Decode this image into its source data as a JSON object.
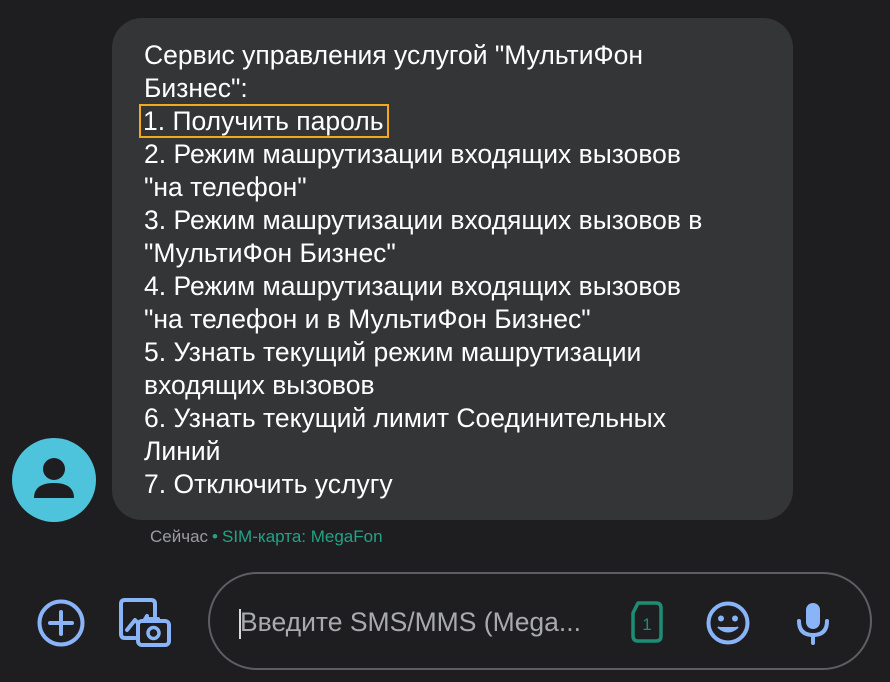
{
  "conversation": {
    "message": {
      "lines": [
        "Сервис управления услугой \"МультиФон",
        "Бизнес\":",
        "1. Получить пароль",
        "2. Режим машрутизации входящих вызовов",
        "\"на телефон\"",
        "3. Режим машрутизации входящих вызовов в",
        "\"МультиФон Бизнес\"",
        "4. Режим машрутизации входящих вызовов",
        "\"на телефон и в МультиФон Бизнес\"",
        "5. Узнать текущий режим машрутизации",
        "входящих вызовов",
        "6. Узнать текущий лимит Соединительных",
        "Линий",
        "7. Отключить услугу"
      ],
      "time": "Сейчас",
      "separator": "•",
      "sim": "SIM-карта: MegaFon"
    },
    "avatar_icon": "person-icon",
    "highlight_color": "#f3a91b"
  },
  "composer": {
    "placeholder": "Введите SMS/MMS (Mega...",
    "sim_slot": "1",
    "icons": {
      "add": "plus-circle-icon",
      "gallery": "gallery-camera-icon",
      "sim": "sim-card-icon",
      "emoji": "emoji-icon",
      "mic": "microphone-icon"
    }
  },
  "colors": {
    "background": "#1e1e20",
    "bubble": "#343537",
    "accent": "#8ab4f8",
    "sim_green": "#22a386",
    "avatar": "#4ec4dc"
  }
}
